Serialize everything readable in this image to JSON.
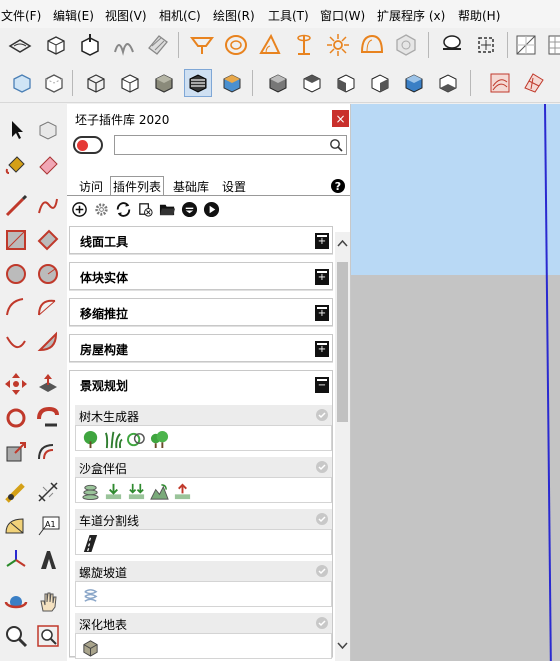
{
  "menu": [
    "文件(F)",
    "编辑(E)",
    "视图(V)",
    "相机(C)",
    "绘图(R)",
    "工具(T)",
    "窗口(W)",
    "扩展程序 (x)",
    "帮助(H)"
  ],
  "panel": {
    "title": "坯子插件库 2020",
    "close": "×",
    "search_placeholder": "",
    "search_value": "",
    "tabs": [
      "访问",
      "插件列表",
      "基础库",
      "设置"
    ],
    "active_tab": "插件列表",
    "help": "?",
    "categories": [
      {
        "label": "线面工具",
        "expanded": false
      },
      {
        "label": "体块实体",
        "expanded": false
      },
      {
        "label": "移缩推拉",
        "expanded": false
      },
      {
        "label": "房屋构建",
        "expanded": false
      },
      {
        "label": "景观规划",
        "expanded": true
      }
    ],
    "plugins": [
      {
        "name": "树木生成器",
        "icons": [
          "tree-icon",
          "grass-icon",
          "shrub-icon",
          "forest-icon"
        ]
      },
      {
        "name": "沙盒伴侣",
        "icons": [
          "sandbox-stack-icon",
          "sandbox-drop-icon",
          "sandbox-multi-icon",
          "sandbox-terrain-icon",
          "sandbox-raise-icon"
        ]
      },
      {
        "name": "车道分割线",
        "icons": [
          "lane-divider-icon"
        ]
      },
      {
        "name": "螺旋坡道",
        "icons": [
          "spiral-ramp-icon"
        ]
      },
      {
        "name": "深化地表",
        "icons": [
          "terrain-cube-icon"
        ]
      }
    ]
  },
  "colors": {
    "sky": "#b9d9f5",
    "ground": "#c4c4c4",
    "close_button": "#c9302c",
    "toggle_knob": "#e53935",
    "blue_axis": "#2a2ad0"
  }
}
